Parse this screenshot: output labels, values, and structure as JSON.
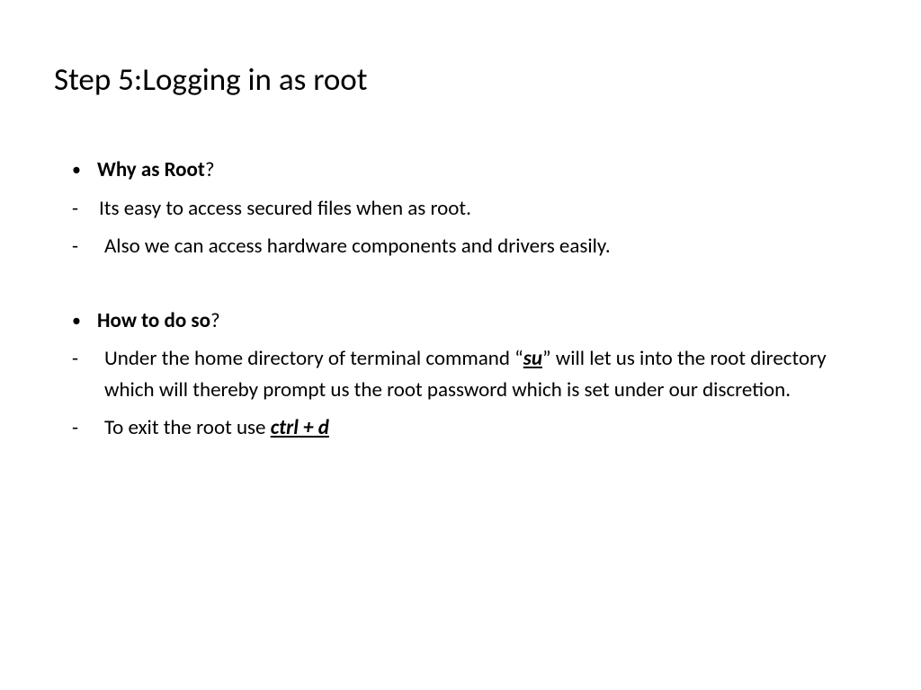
{
  "title": "Step 5:Logging in as root",
  "section1": {
    "heading_bold": "Why as Root",
    "heading_suffix": "?",
    "point1": "Its easy to access secured files when as root.",
    "point2": "Also we can access hardware components and drivers easily."
  },
  "section2": {
    "heading_bold": "How to do so",
    "heading_suffix": "?",
    "point1_prefix": "Under the home directory of terminal command “",
    "point1_cmd": "su",
    "point1_suffix": "” will let us into the root directory which will thereby prompt us the root password which is set under our discretion.",
    "point2_prefix": "To exit the root use ",
    "point2_cmd": "ctrl + d"
  },
  "markers": {
    "bullet": "•",
    "dash": "-"
  }
}
